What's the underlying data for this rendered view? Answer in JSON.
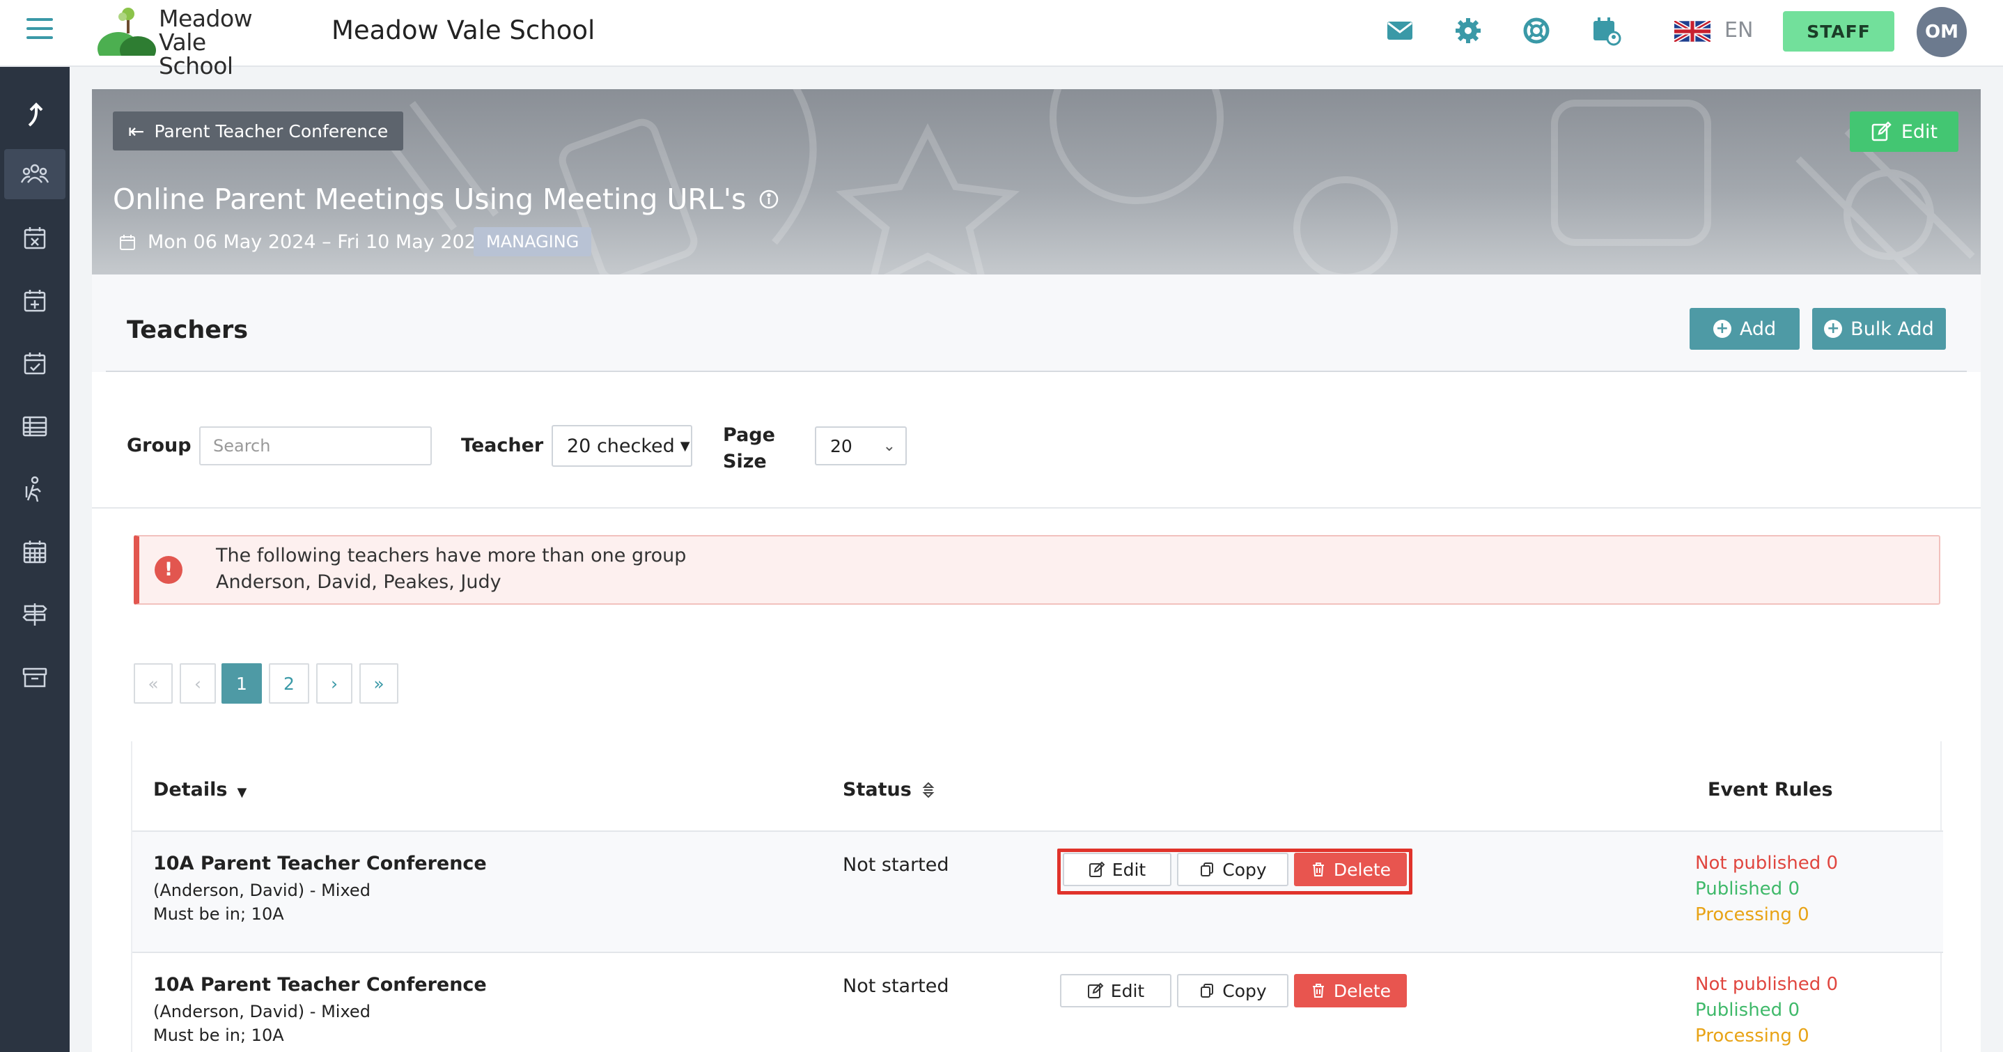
{
  "header": {
    "logo_line1": "Meadow",
    "logo_line2": "Vale School",
    "school_name": "Meadow Vale School",
    "language": "EN",
    "staff_label": "STAFF",
    "avatar_initials": "OM",
    "icons": [
      "envelope-icon",
      "gear-icon",
      "lifebuoy-icon",
      "calendar-user-icon",
      "uk-flag-icon"
    ],
    "accent_color": "#3a99a7"
  },
  "sidebar": {
    "items": [
      "arrow-up-icon",
      "users-icon",
      "calendar-x-icon",
      "calendar-plus-icon",
      "calendar-check-icon",
      "table-icon",
      "person-walking-icon",
      "calendar-grid-icon",
      "signpost-icon",
      "archive-icon"
    ],
    "active_index": 1
  },
  "banner": {
    "back_label": "Parent Teacher Conference",
    "edit_label": "Edit",
    "title": "Online Parent Meetings Using Meeting URL's",
    "dates": "Mon 06 May 2024 – Fri 10 May 2024",
    "badge": "MANAGING"
  },
  "section": {
    "title": "Teachers",
    "add_label": "Add",
    "bulk_add_label": "Bulk Add"
  },
  "filters": {
    "group_label": "Group",
    "search_placeholder": "Search",
    "teacher_label": "Teacher",
    "teacher_value": "20 checked",
    "page_size_label_line1": "Page",
    "page_size_label_line2": "Size",
    "page_size_value": "20"
  },
  "alert": {
    "line1": "The following teachers have more than one group",
    "line2": "Anderson, David, Peakes, Judy"
  },
  "pagination": {
    "first": "«",
    "prev": "‹",
    "pages": [
      "1",
      "2"
    ],
    "current": "1",
    "next": "›",
    "last": "»"
  },
  "table": {
    "headers": {
      "details": "Details",
      "status": "Status",
      "event_rules": "Event Rules"
    },
    "rows": [
      {
        "title": "10A Parent Teacher Conference",
        "teachers": "(Anderson, David) - Mixed",
        "must_be_in": "Must be in; 10A",
        "status": "Not started",
        "edit": "Edit",
        "copy": "Copy",
        "delete": "Delete",
        "not_published": "Not published 0",
        "published": "Published 0",
        "processing": "Processing 0"
      },
      {
        "title": "10A Parent Teacher Conference",
        "teachers": "(Anderson, David) - Mixed",
        "must_be_in": "Must be in; 10A",
        "status": "Not started",
        "edit": "Edit",
        "copy": "Copy",
        "delete": "Delete",
        "not_published": "Not published 0",
        "published": "Published 0",
        "processing": "Processing 0"
      }
    ]
  }
}
